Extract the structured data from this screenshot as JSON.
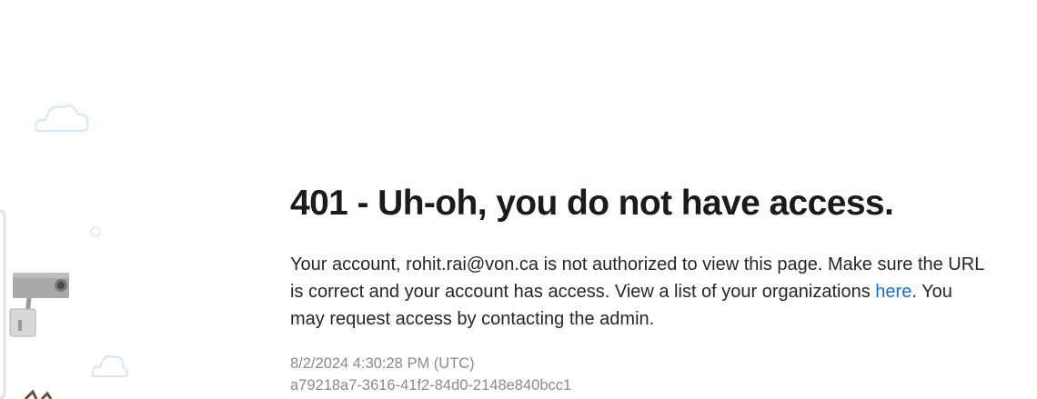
{
  "error": {
    "title": "401 - Uh-oh, you do not have access.",
    "message": {
      "before_email": "Your account, ",
      "email": "rohit.rai@von.ca",
      "after_email": " is not authorized to view this page. Make sure the URL is correct and your account has access. View a list of your organizations ",
      "link_text": "here",
      "after_link": ". You may request access by contacting the admin."
    },
    "timestamp": "8/2/2024 4:30:28 PM (UTC)",
    "activity_id": "a79218a7-3616-41f2-84d0-2148e840bcc1"
  },
  "illustration": {
    "icons": [
      "cloud-icon",
      "security-camera-icon"
    ],
    "colors": {
      "cloud_outline": "#d3e6f5",
      "camera_body": "#a8a8a8",
      "link": "#1a6fd1"
    }
  }
}
